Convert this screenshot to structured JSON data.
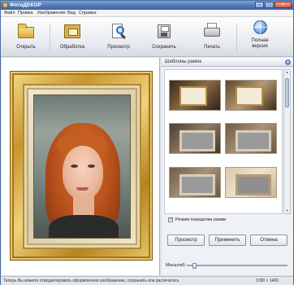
{
  "window": {
    "title": "ФотоДЕКОР"
  },
  "menu": [
    "Файл",
    "Правка",
    "Изображение",
    "Вид",
    "Справка"
  ],
  "toolbar": {
    "buttons": [
      {
        "label": "Открыть",
        "icon": "folder-icon"
      },
      {
        "label": "Обработка",
        "icon": "frame-icon"
      },
      {
        "label": "Просмотр",
        "icon": "magnifier-icon"
      },
      {
        "label": "Сохранить",
        "icon": "disk-icon"
      },
      {
        "label": "Печать",
        "icon": "printer-icon"
      },
      {
        "label_line1": "Полная",
        "label_line2": "версия",
        "icon": "globe-icon"
      }
    ]
  },
  "panel": {
    "title": "Шаблоны рамок",
    "checkbox_label": "Режим переделки рамки",
    "checkbox_checked": true,
    "buttons": [
      "Просмотр",
      "Применить",
      "Отмена"
    ],
    "zoom_label": "Масштаб:",
    "zoom_level": 0.05
  },
  "status": {
    "text": "Теперь Вы можете отредактировать оформленное изображение, сохранить или распечатать",
    "size": "1090 × 1400"
  },
  "colors": {
    "accent": "#4f76b5",
    "frame_gold": "#c9952c"
  }
}
